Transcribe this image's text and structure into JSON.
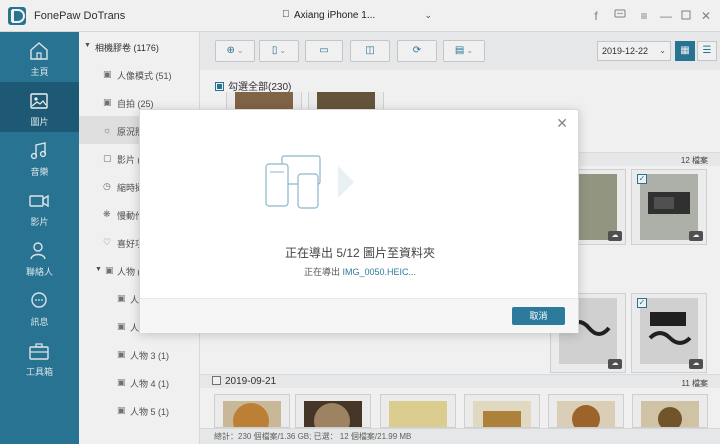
{
  "app": {
    "title": "FonePaw DoTrans"
  },
  "device": {
    "name": "Axiang iPhone 1..."
  },
  "nav": [
    {
      "key": "home",
      "label": "主頁"
    },
    {
      "key": "photos",
      "label": "圖片"
    },
    {
      "key": "music",
      "label": "音樂"
    },
    {
      "key": "videos",
      "label": "影片"
    },
    {
      "key": "contacts",
      "label": "聯絡人"
    },
    {
      "key": "messages",
      "label": "訊息"
    },
    {
      "key": "toolbox",
      "label": "工具箱"
    }
  ],
  "albums": {
    "root": "相機膠卷 (1176)",
    "items": [
      {
        "label": "人像模式 (51)"
      },
      {
        "label": "自拍 (25)"
      },
      {
        "label": "原況照"
      },
      {
        "label": "影片 ("
      },
      {
        "label": "縮時攝"
      },
      {
        "label": "慢動作"
      },
      {
        "label": "喜好項"
      }
    ],
    "people_group": "人物 (",
    "people": [
      {
        "label": "人"
      },
      {
        "label": "人"
      },
      {
        "label": "人物 3 (1)"
      },
      {
        "label": "人物 4 (1)"
      },
      {
        "label": "人物 5 (1)"
      }
    ]
  },
  "toolbar": {
    "date": "2019-12-22"
  },
  "content": {
    "select_all": "勾選全部(230)",
    "group1_count": "12 檔案",
    "group2_date": "2019-09-21",
    "group2_count": "11 檔案"
  },
  "status": {
    "text": "總計：230 個檔案/1.36 GB; 已選： 12 個檔案/21.99 MB"
  },
  "modal": {
    "title": "正在導出 5/12 圖片至資料夾",
    "sub_prefix": "正在導出 ",
    "filename": "IMG_0050.HEIC...",
    "cancel": "取消"
  },
  "colors": {
    "accent": "#2c7b9c",
    "nav_bg": "#2c7b9c",
    "nav_active": "#1f5f7c"
  }
}
